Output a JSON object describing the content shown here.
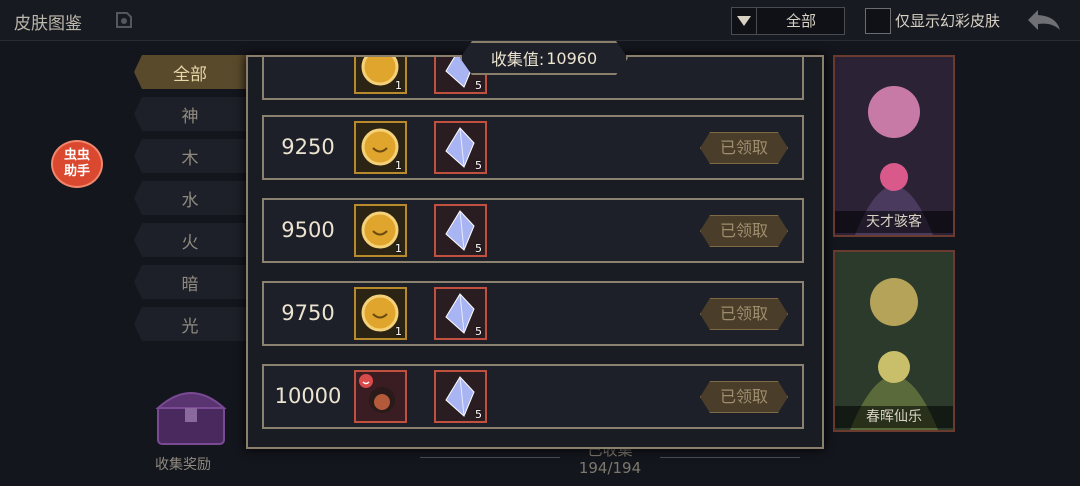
{
  "header": {
    "title": "皮肤图鉴",
    "filter_value": "全部",
    "toggle_label": "仅显示幻彩皮肤"
  },
  "categories": [
    "全部",
    "神",
    "木",
    "水",
    "火",
    "暗",
    "光"
  ],
  "helper_label": "虫虫助手",
  "chest_label": "收集奖励",
  "progress": {
    "label": "已收集",
    "count": "194/194"
  },
  "cards": [
    {
      "name": "天才骇客"
    },
    {
      "name": "春晖仙乐"
    }
  ],
  "collection": {
    "total_label": "收集值:",
    "total_value": "10960",
    "rows": [
      {
        "threshold": "9250",
        "item1_count": "1",
        "item2_count": "5",
        "status": "已领取"
      },
      {
        "threshold": "9500",
        "item1_count": "1",
        "item2_count": "5",
        "status": "已领取"
      },
      {
        "threshold": "9750",
        "item1_count": "1",
        "item2_count": "5",
        "status": "已领取"
      },
      {
        "threshold": "10000",
        "item1_count": "",
        "item2_count": "5",
        "status": "已领取"
      }
    ],
    "partial_row": {
      "item1_count": "1",
      "item2_count": "5"
    }
  },
  "colors": {
    "accent_gold": "#b98a2b",
    "frame": "#8a7f6b",
    "claimed": "#4a3d2a"
  }
}
